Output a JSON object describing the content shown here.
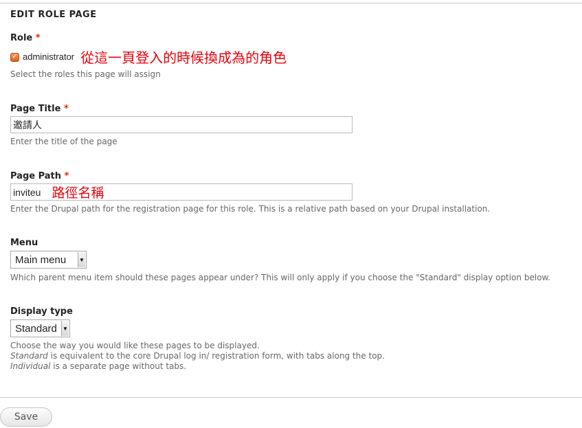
{
  "fieldset": {
    "legend": "EDIT ROLE PAGE"
  },
  "role": {
    "label": "Role",
    "required_marker": "*",
    "option_label": "administrator",
    "checked": true,
    "annotation": "從這一頁登入的時候換成為的角色",
    "description": "Select the roles this page will assign"
  },
  "page_title": {
    "label": "Page Title",
    "required_marker": "*",
    "value": "邀請人",
    "description": "Enter the title of the page"
  },
  "page_path": {
    "label": "Page Path",
    "required_marker": "*",
    "value": "inviteu",
    "annotation": "路徑名稱",
    "description": "Enter the Drupal path for the registration page for this role. This is a relative path based on your Drupal installation."
  },
  "menu": {
    "label": "Menu",
    "selected": "Main menu",
    "description": "Which parent menu item should these pages appear under? This will only apply if you choose the \"Standard\" display option below."
  },
  "display_type": {
    "label": "Display type",
    "selected": "Standard",
    "description_line1": "Choose the way you would like these pages to be displayed.",
    "standard_term": "Standard",
    "standard_text": " is equivalent to the core Drupal log in/ registration form, with tabs along the top.",
    "individual_term": "Individual",
    "individual_text": " is a separate page without tabs."
  },
  "actions": {
    "save_label": "Save"
  },
  "colors": {
    "required": "#e32700",
    "annotation": "#e8000b",
    "checkbox": "#e0712c"
  }
}
